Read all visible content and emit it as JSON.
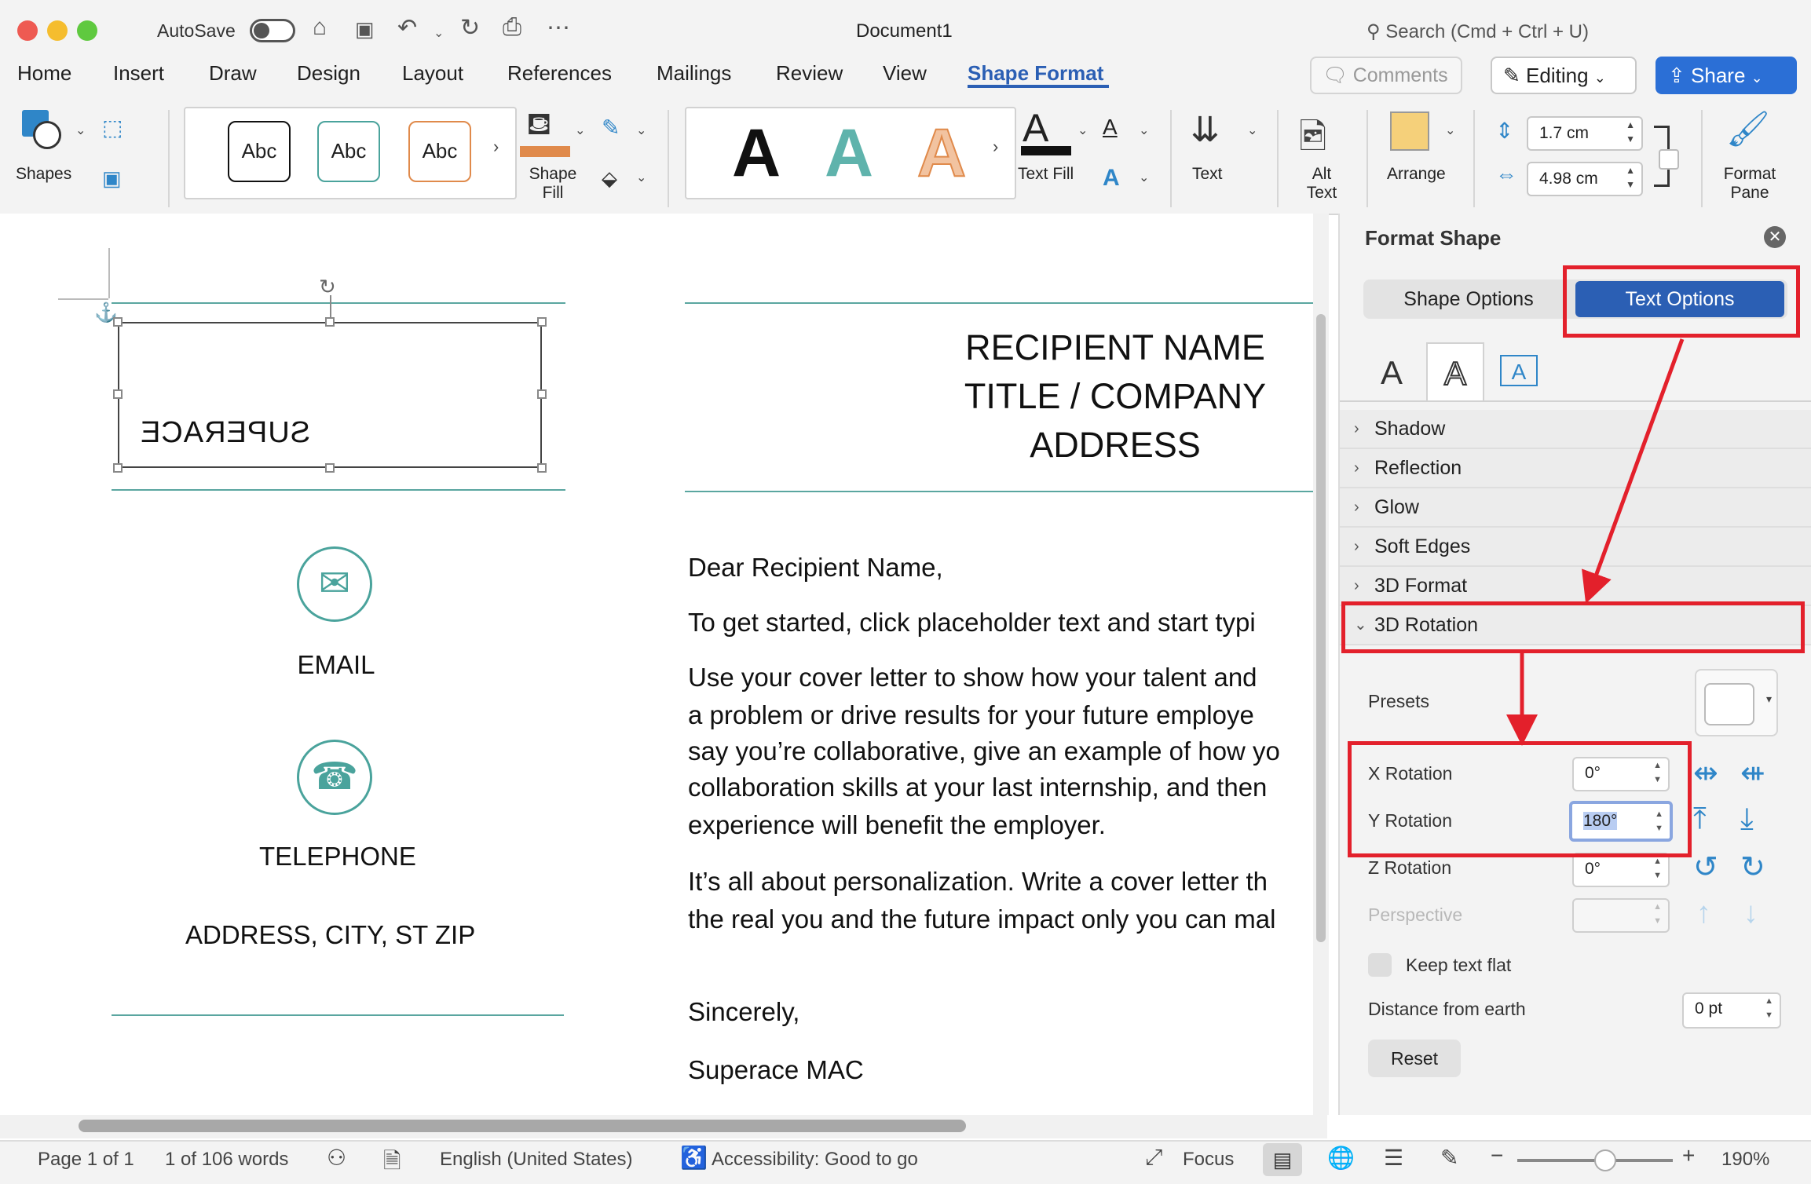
{
  "window": {
    "title": "Document1",
    "autosave_label": "AutoSave",
    "search_placeholder": "Search (Cmd + Ctrl + U)"
  },
  "tabs": [
    "Home",
    "Insert",
    "Draw",
    "Design",
    "Layout",
    "References",
    "Mailings",
    "Review",
    "View",
    "Shape Format"
  ],
  "active_tab": "Shape Format",
  "header_buttons": {
    "comments": "Comments",
    "editing": "Editing",
    "share": "Share"
  },
  "ribbon": {
    "shapes": "Shapes",
    "style_presets": [
      "Abc",
      "Abc",
      "Abc"
    ],
    "shape_fill": "Shape Fill",
    "wordart_letters": [
      "A",
      "A",
      "A"
    ],
    "text_fill": "Text Fill",
    "text": "Text",
    "alt_text": "Alt Text",
    "arrange": "Arrange",
    "height": "1.7 cm",
    "width": "4.98 cm",
    "format_pane": "Format Pane"
  },
  "document": {
    "textbox_text": "SUPERACE",
    "recipient_lines": [
      "RECIPIENT NAME",
      "TITLE / COMPANY",
      "ADDRESS"
    ],
    "email_label": "EMAIL",
    "telephone_label": "TELEPHONE",
    "address_label": "ADDRESS, CITY, ST ZIP",
    "greeting": "Dear Recipient Name,",
    "para1": "To get started, click placeholder text and start typi",
    "para2_lines": [
      "Use your cover letter to show how your talent and",
      "a problem or drive results for your future employe",
      "say you’re collaborative, give an example of how yo",
      "collaboration skills at your last internship, and then",
      "experience will benefit the employer."
    ],
    "para3_lines": [
      "It’s all about personalization. Write a cover letter th",
      "the real you and the future impact only you can mal"
    ],
    "closing": "Sincerely,",
    "signature": "Superace MAC"
  },
  "format_pane": {
    "title": "Format Shape",
    "tabs": [
      "Shape Options",
      "Text Options"
    ],
    "active_tab": "Text Options",
    "sections": [
      "Shadow",
      "Reflection",
      "Glow",
      "Soft Edges",
      "3D Format",
      "3D Rotation"
    ],
    "expanded_section": "3D Rotation",
    "presets_label": "Presets",
    "x_rotation_label": "X Rotation",
    "x_rotation_value": "0°",
    "y_rotation_label": "Y Rotation",
    "y_rotation_value": "180°",
    "z_rotation_label": "Z Rotation",
    "z_rotation_value": "0°",
    "perspective_label": "Perspective",
    "keep_text_flat_label": "Keep text flat",
    "distance_label": "Distance from earth",
    "distance_value": "0 pt",
    "reset_label": "Reset"
  },
  "status_bar": {
    "page": "Page 1 of 1",
    "words": "1 of 106 words",
    "language": "English (United States)",
    "accessibility": "Accessibility: Good to go",
    "focus": "Focus",
    "zoom": "190%"
  },
  "colors": {
    "accent": "#2b5fb4",
    "annotation_red": "#e3202b",
    "teal": "#4aa39c"
  },
  "icons": [
    "close-red",
    "search-icon",
    "home-icon",
    "save-icon",
    "undo-icon",
    "redo-icon",
    "print-icon",
    "more-icon"
  ]
}
